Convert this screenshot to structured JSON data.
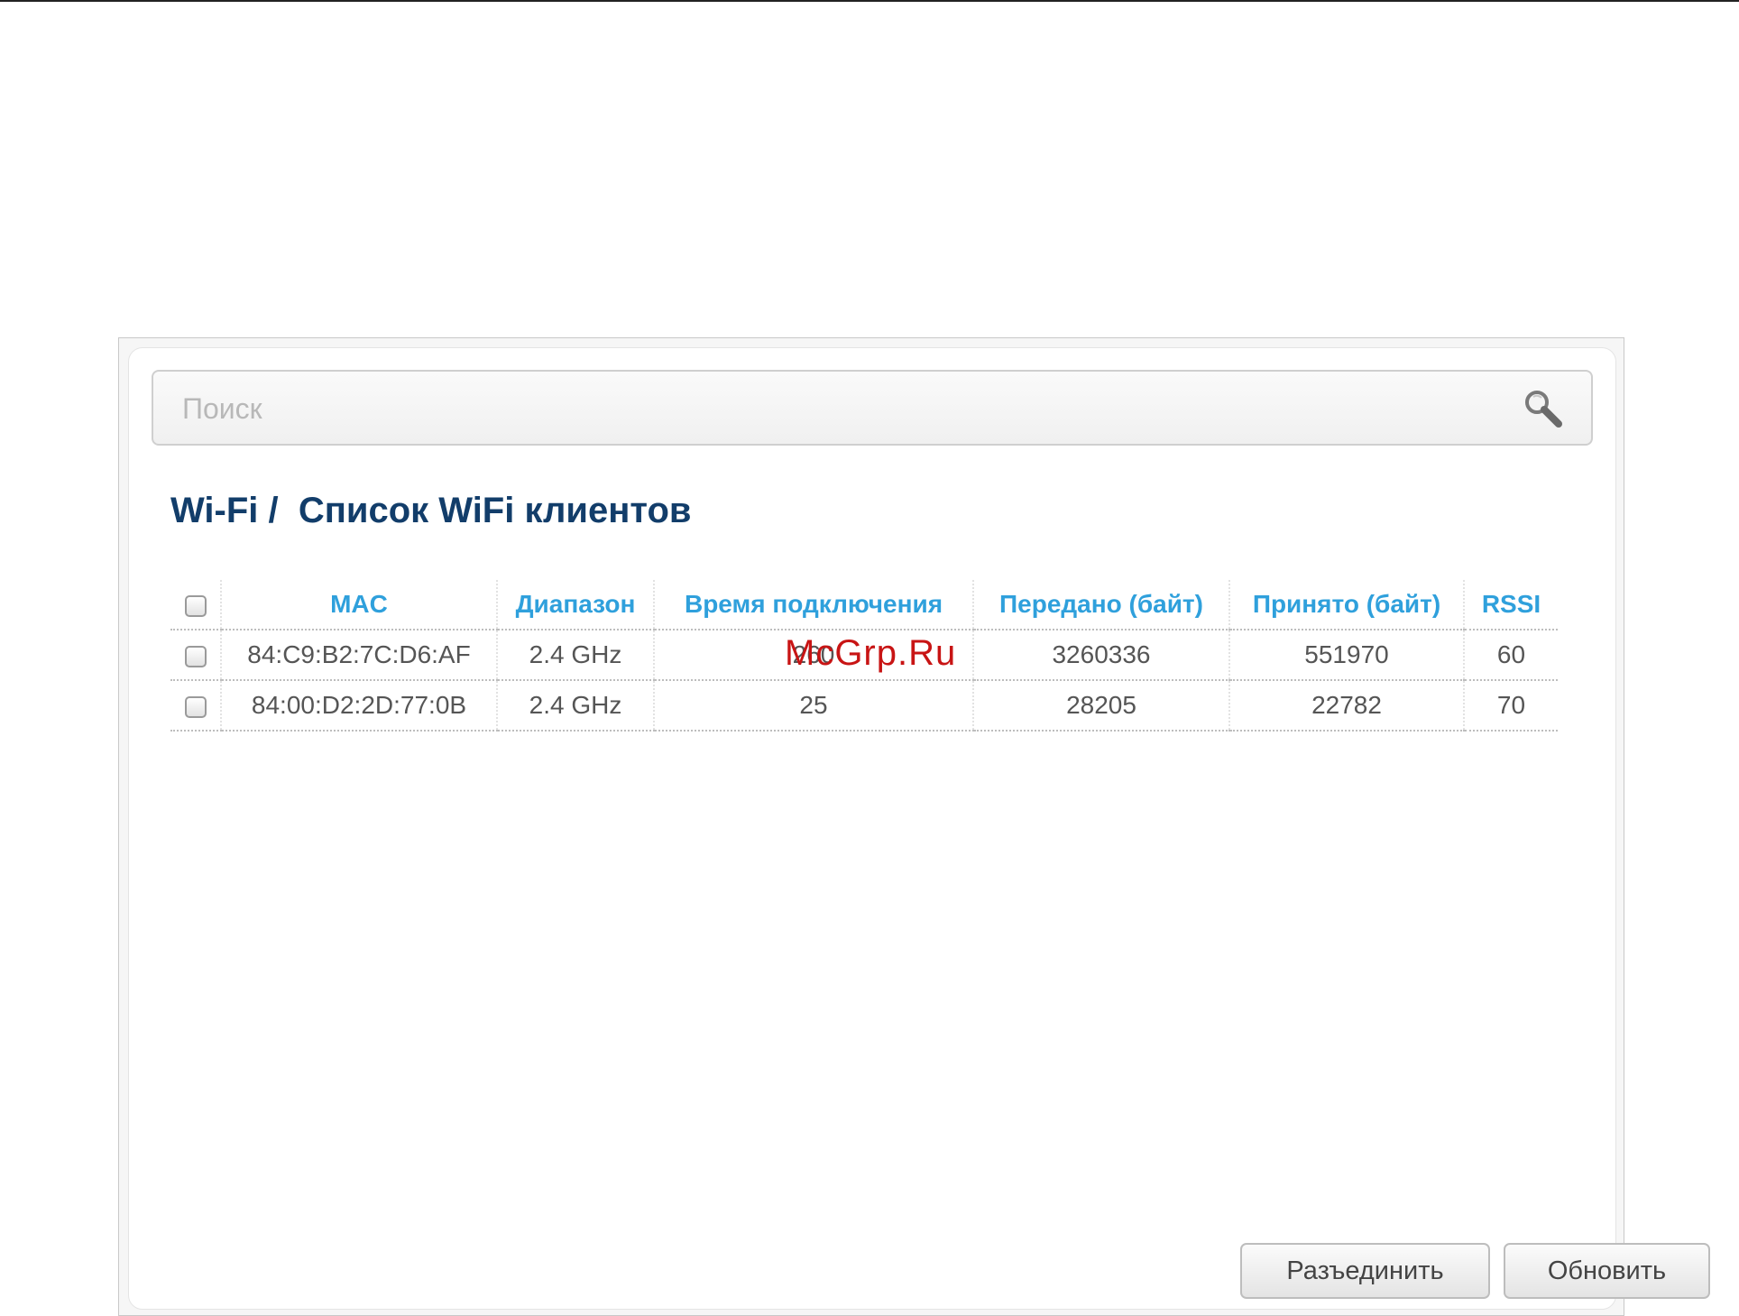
{
  "search": {
    "placeholder": "Поиск",
    "icon": "search-icon"
  },
  "header": {
    "title": "Wi-Fi /  Список WiFi клиентов"
  },
  "table": {
    "columns": [
      "MAC",
      "Диапазон",
      "Время подключения",
      "Передано (байт)",
      "Принято (байт)",
      "RSSI"
    ],
    "rows": [
      {
        "mac": "84:C9:B2:7C:D6:AF",
        "band": "2.4 GHz",
        "time": "260",
        "sent": "3260336",
        "received": "551970",
        "rssi": "60"
      },
      {
        "mac": "84:00:D2:2D:77:0B",
        "band": "2.4 GHz",
        "time": "25",
        "sent": "28205",
        "received": "22782",
        "rssi": "70"
      }
    ]
  },
  "buttons": {
    "disconnect": "Разъединить",
    "refresh": "Обновить"
  },
  "watermark": "McGrp.Ru",
  "colors": {
    "title": "#123d6a",
    "column_header": "#2fa0dc",
    "watermark": "#c81414"
  }
}
